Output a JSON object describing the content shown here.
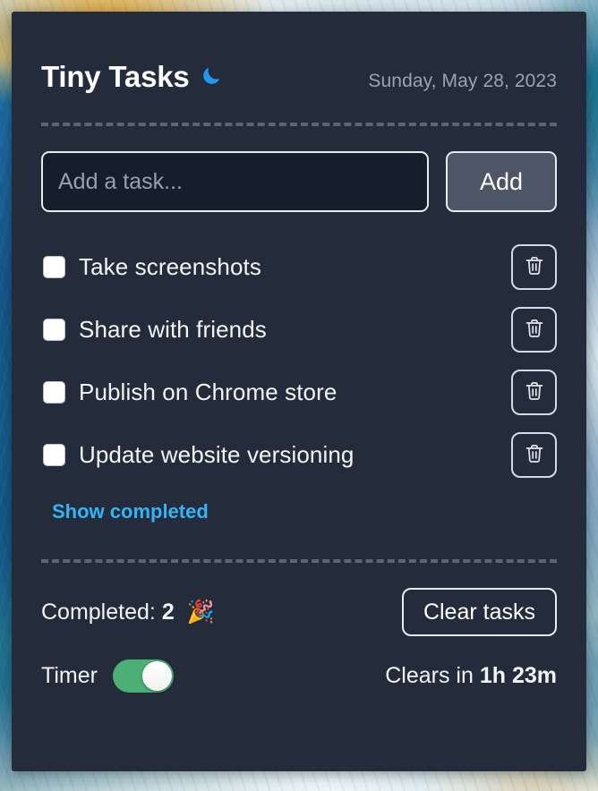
{
  "app": {
    "title": "Tiny Tasks",
    "theme_icon": "moon-icon",
    "date": "Sunday, May 28, 2023",
    "accent_link_color": "#34b3f5",
    "moon_color": "#2196f3",
    "toggle_on_color": "#4caf76",
    "card_bg": "#242c3c"
  },
  "add": {
    "placeholder": "Add a task...",
    "value": "",
    "button_label": "Add"
  },
  "tasks": [
    {
      "label": "Take screenshots",
      "checked": false,
      "delete_icon": "trash-icon"
    },
    {
      "label": "Share with friends",
      "checked": false,
      "delete_icon": "trash-icon"
    },
    {
      "label": "Publish on Chrome store",
      "checked": false,
      "delete_icon": "trash-icon"
    },
    {
      "label": "Update website versioning",
      "checked": false,
      "delete_icon": "trash-icon"
    }
  ],
  "show_completed_label": "Show completed",
  "footer": {
    "completed_label": "Completed:",
    "completed_count": "2",
    "completed_icon": "🎉",
    "clear_button_label": "Clear tasks",
    "timer_label": "Timer",
    "timer_on": true,
    "clears_prefix": "Clears in",
    "clears_value": "1h 23m"
  }
}
